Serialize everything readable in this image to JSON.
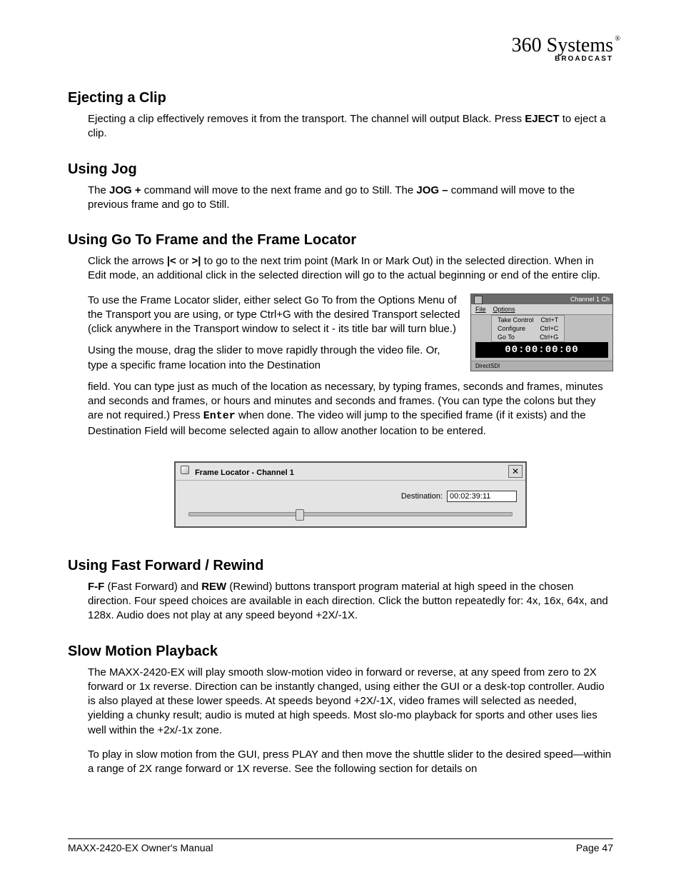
{
  "logo": {
    "main": "360 Systems",
    "sub": "BROADCAST",
    "reg": "®"
  },
  "sections": {
    "ejecting": {
      "heading": "Ejecting a Clip",
      "p1a": "Ejecting a clip effectively removes it from the transport. The channel will output Black. Press ",
      "p1b": "EJECT",
      "p1c": " to eject a clip."
    },
    "jog": {
      "heading": "Using Jog",
      "p1a": "The ",
      "p1b": "JOG +",
      "p1c": " command will move to the next frame and go to Still.  The ",
      "p1d": "JOG –",
      "p1e": " command will move to the previous frame and go to Still."
    },
    "goto": {
      "heading": "Using Go To Frame and the Frame Locator",
      "p1a": "Click the arrows ",
      "p1b": "|<",
      "p1c": " or ",
      "p1d": ">|",
      "p1e": " to go to the next trim point (Mark In or Mark Out) in the selected direction.  When in Edit mode, an additional click in the selected direction will go to the actual beginning or end of the entire clip.",
      "p2a": "To use the Frame Locator slider, either select Go To from the Options Menu of the Transport you are using, or type ",
      "p2b": "Ctrl+G",
      "p2c": " with the desired Transport selected (click anywhere in the Transport window to select it - its title bar will turn blue.)",
      "p3": "Using the mouse, drag the slider to move rapidly through the video file. Or, type a specific frame location into the Destination",
      "p4a": "field.  You can type just as much of the location as necessary, by typing frames, seconds and frames, minutes and seconds and frames, or hours and minutes and seconds and frames.  (You can type the colons but they are not required.)  Press ",
      "p4b": "Enter",
      "p4c": " when done. The video will jump to the specified frame (if it exists) and the Destination Field will become selected again to allow another location to be entered."
    },
    "ffrew": {
      "heading": "Using Fast Forward / Rewind",
      "p1a": "F-F",
      "p1b": " (Fast Forward) and ",
      "p1c": "REW",
      "p1d": " (Rewind) buttons transport program material at high speed in the chosen direction.  Four speed choices are available in each direction. Click the button repeatedly for: 4x, 16x, 64x, and 128x.  Audio does not play at any speed beyond +2X/-1X."
    },
    "slomo": {
      "heading": "Slow Motion Playback",
      "p1": "The MAXX-2420-EX will play smooth slow-motion video in forward or reverse, at any speed from zero to 2X forward or 1x reverse. Direction can be instantly changed, using either the GUI or a desk-top controller. Audio is also played at these lower speeds. At speeds beyond +2X/-1X, video frames will selected as needed, yielding a chunky result; audio is muted at high speeds. Most slo-mo playback for sports and other uses lies well within the +2x/-1x zone.",
      "p2": "To play in slow motion from the GUI, press PLAY and then move the shuttle slider to the desired speed—within a range of 2X range forward or 1X reverse. See the following section for details on"
    }
  },
  "transport_fig": {
    "titlebar": "Channel  1 Ch",
    "menubar": {
      "file": "File",
      "options": "Options"
    },
    "menu_items": {
      "take": {
        "label": "Take Control",
        "key": "Ctrl+T"
      },
      "conf": {
        "label": "Configure",
        "key": "Ctrl+C"
      },
      "goto": {
        "label": "Go To",
        "key": "Ctrl+G"
      }
    },
    "counter": "00:00:00:00",
    "bottombar": "DirectSDI"
  },
  "frame_locator": {
    "title": "Frame Locator - Channel 1",
    "dest_label": "Destination:",
    "dest_value": "00:02:39:11"
  },
  "footer": {
    "left": "MAXX-2420-EX Owner's Manual",
    "right": "Page 47"
  }
}
